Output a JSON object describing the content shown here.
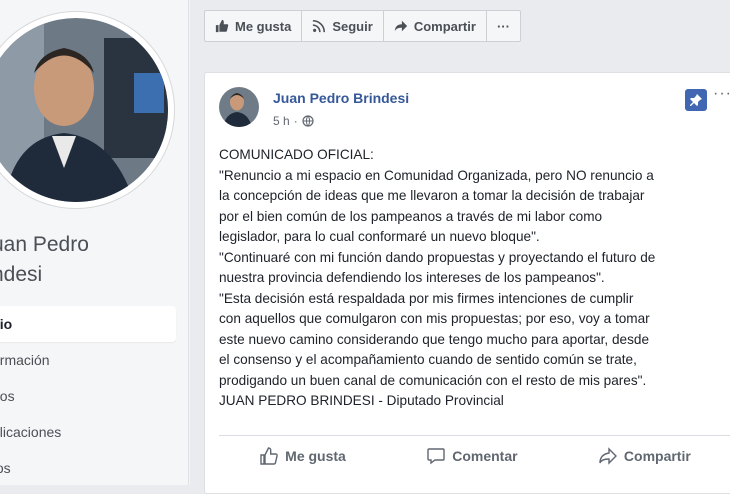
{
  "sidebar": {
    "name_line1": "uan Pedro",
    "name_line2": "ndesi",
    "nav": [
      "cio",
      "ormación",
      "eos",
      "plicaciones",
      "tos"
    ]
  },
  "actions": {
    "like": "Me gusta",
    "follow": "Seguir",
    "share": "Compartir",
    "more": "···"
  },
  "post": {
    "author": "Juan Pedro Brindesi",
    "time": "5 h",
    "more": "···",
    "lines": [
      "COMUNICADO OFICIAL:",
      "\"Renuncio a mi espacio en Comunidad Organizada, pero NO renuncio a",
      "la concepción de ideas que me llevaron a tomar la decisión de trabajar",
      "por el bien común de los pampeanos a través de mi labor como",
      "legislador, para lo cual conformaré un nuevo bloque\".",
      "\"Continuaré con mi función dando propuestas y proyectando el futuro de",
      "nuestra provincia defendiendo los intereses de los pampeanos\".",
      "\"Esta decisión está respaldada por mis firmes intenciones de cumplir",
      "con aquellos que comulgaron con mis propuestas; por eso, voy a tomar",
      "este nuevo camino considerando que tengo mucho para aportar, desde",
      "el consenso y el acompañamiento cuando de sentido común se trate,",
      "prodigando un buen canal de comunicación con el resto de mis pares\".",
      "JUAN PEDRO BRINDESI - Diputado Provincial"
    ],
    "footer": {
      "like": "Me gusta",
      "comment": "Comentar",
      "share": "Compartir"
    }
  },
  "colors": {
    "link": "#365899",
    "accent": "#4267b2",
    "background": "#e9ebee"
  }
}
